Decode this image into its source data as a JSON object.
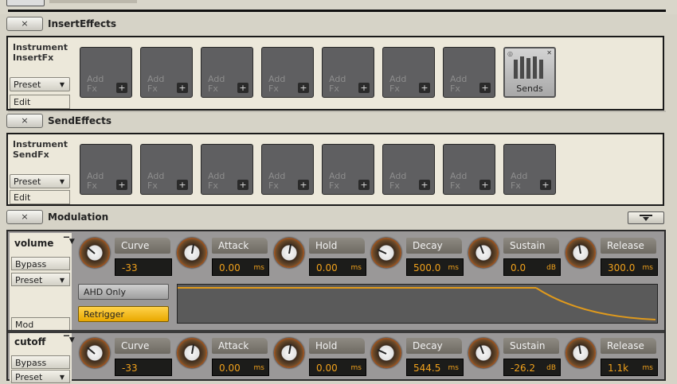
{
  "insert_section": {
    "close_label": "×",
    "title": "InsertEffects"
  },
  "insert_panel": {
    "label_line1": "Instrument",
    "label_line2": "InsertFx",
    "preset_label": "Preset",
    "edit_label": "Edit",
    "slots": [
      {
        "line1": "Add",
        "line2": "Fx",
        "plus": "+"
      },
      {
        "line1": "Add",
        "line2": "Fx",
        "plus": "+"
      },
      {
        "line1": "Add",
        "line2": "Fx",
        "plus": "+"
      },
      {
        "line1": "Add",
        "line2": "Fx",
        "plus": "+"
      },
      {
        "line1": "Add",
        "line2": "Fx",
        "plus": "+"
      },
      {
        "line1": "Add",
        "line2": "Fx",
        "plus": "+"
      },
      {
        "line1": "Add",
        "line2": "Fx",
        "plus": "+"
      }
    ],
    "sends_label": "Sends"
  },
  "send_section": {
    "close_label": "×",
    "title": "SendEffects"
  },
  "send_panel": {
    "label_line1": "Instrument",
    "label_line2": "SendFx",
    "preset_label": "Preset",
    "edit_label": "Edit",
    "slots": [
      {
        "line1": "Add",
        "line2": "Fx",
        "plus": "+"
      },
      {
        "line1": "Add",
        "line2": "Fx",
        "plus": "+"
      },
      {
        "line1": "Add",
        "line2": "Fx",
        "plus": "+"
      },
      {
        "line1": "Add",
        "line2": "Fx",
        "plus": "+"
      },
      {
        "line1": "Add",
        "line2": "Fx",
        "plus": "+"
      },
      {
        "line1": "Add",
        "line2": "Fx",
        "plus": "+"
      },
      {
        "line1": "Add",
        "line2": "Fx",
        "plus": "+"
      },
      {
        "line1": "Add",
        "line2": "Fx",
        "plus": "+"
      }
    ]
  },
  "mod_section": {
    "close_label": "×",
    "title": "Modulation"
  },
  "mod_volume": {
    "name": "volume",
    "bypass_label": "Bypass",
    "preset_label": "Preset",
    "mod_label": "Mod",
    "ahd_label": "AHD Only",
    "retrigger_label": "Retrigger",
    "params": [
      {
        "name": "Curve",
        "value": "-33",
        "unit": ""
      },
      {
        "name": "Attack",
        "value": "0.00",
        "unit": "ms"
      },
      {
        "name": "Hold",
        "value": "0.00",
        "unit": "ms"
      },
      {
        "name": "Decay",
        "value": "500.0",
        "unit": "ms"
      },
      {
        "name": "Sustain",
        "value": "0.0",
        "unit": "dB"
      },
      {
        "name": "Release",
        "value": "300.0",
        "unit": "ms"
      }
    ]
  },
  "mod_cutoff": {
    "name": "cutoff",
    "bypass_label": "Bypass",
    "preset_label": "Preset",
    "params": [
      {
        "name": "Curve",
        "value": "-33",
        "unit": ""
      },
      {
        "name": "Attack",
        "value": "0.00",
        "unit": "ms"
      },
      {
        "name": "Hold",
        "value": "0.00",
        "unit": "ms"
      },
      {
        "name": "Decay",
        "value": "544.5",
        "unit": "ms"
      },
      {
        "name": "Sustain",
        "value": "-26.2",
        "unit": "dB"
      },
      {
        "name": "Release",
        "value": "1.1k",
        "unit": "ms"
      }
    ]
  },
  "colors": {
    "accent": "#f0a11c",
    "panel_bg": "#ece8da",
    "slot_bg": "#5f5f61",
    "retrigger_bg": "#ffd24a"
  }
}
